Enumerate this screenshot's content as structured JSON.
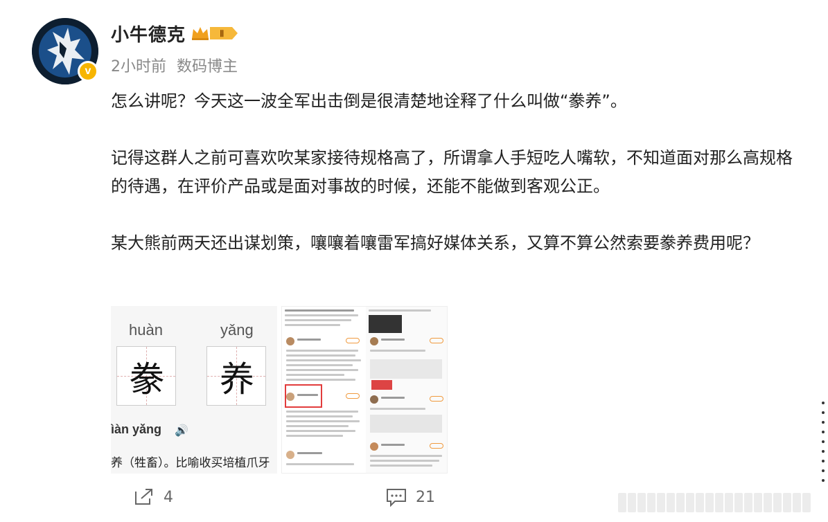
{
  "user": {
    "name": "小牛德克",
    "level_badge": "Ⅱ",
    "verified_mark": "v",
    "time": "2小时前",
    "tag": "数码博主"
  },
  "post": {
    "paragraphs": [
      "怎么讲呢？今天这一波全军出击倒是很清楚地诠释了什么叫做“豢养”。",
      "记得这群人之前可喜欢吹某家接待规格高了，所谓拿人手短吃人嘴软，不知道面对那么高规格的待遇，在评价产品或是面对事故的时候，还能不能做到客观公正。",
      "某大熊前两天还出谋划策，嚷嚷着嚷雷军搞好媒体关系，又算不算公然索要豢养费用呢？"
    ]
  },
  "image1": {
    "pinyin1": "huàn",
    "pinyin2": "yǎng",
    "char1": "豢",
    "char2": "养",
    "pinyin_line": "ìàn yǎng",
    "definition": "养（牲畜）。比喻收买培植爪牙"
  },
  "actions": {
    "share_count": "4",
    "comment_count": "21"
  },
  "icons": {
    "share": "share-icon",
    "comment": "comment-icon",
    "speaker": "speaker-icon",
    "crown": "crown-icon"
  },
  "colors": {
    "verified": "#f7b500",
    "crown": "#f0a01e",
    "text_primary": "#222222",
    "text_meta": "#888888"
  }
}
